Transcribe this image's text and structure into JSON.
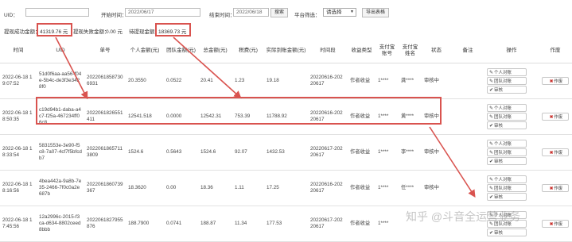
{
  "filter": {
    "uid_label": "UID：",
    "uid_value": "",
    "start_label": "开始时间：",
    "start_value": "2022/06/17",
    "end_label": "结束时间：",
    "end_value": "2022/06/18",
    "search_label": "搜索",
    "platform_label": "平台筛选：",
    "platform_value": "请选择",
    "export_label": "导出表格"
  },
  "summary": {
    "success_label": "提现成功金额：",
    "success_value": "41319.76 元",
    "fail_label": "提现失败金额：",
    "fail_value": "0.00 元",
    "pending_label": "待提现金额：",
    "pending_value": "18369.73 元"
  },
  "table": {
    "headers": [
      "时间",
      "UID",
      "单号",
      "个人金额(元)",
      "团队金额(元)",
      "总金额(元)",
      "税费(元)",
      "实际到账金额(元)",
      "时间段",
      "收益类型",
      "支付宝账号",
      "支付宝姓名",
      "状态",
      "备注",
      "操作",
      "作废"
    ],
    "action_labels": {
      "personal": "个人对账",
      "team": "团队对账",
      "review": "审核"
    },
    "void_label": "作废",
    "rows": [
      {
        "time": "2022-06-18 19:07:52",
        "uid": "51d0f6aa-aa56-f04e-5b4c-de3f3e3428f0",
        "order": "2022061858730 6931",
        "personal": "20.3550",
        "team": "0.0522",
        "total": "20.41",
        "tax": "1.23",
        "actual": "19.18",
        "period": "20220616-20220617",
        "type": "作者收益",
        "account": "1****",
        "name": "龚****",
        "status": "审核中",
        "note": ""
      },
      {
        "time": "2022-06-18 18:50:35",
        "uid": "c19d94b1-daba-a4c7-f25a-467234ff06c8",
        "order": "2022061826551411",
        "personal": "12541.518",
        "team": "0.0000",
        "total": "12542.31",
        "tax": "753.39",
        "actual": "11788.92",
        "period": "20220616-20220617",
        "type": "作者收益",
        "account": "1****",
        "name": "黄****",
        "status": "审核中",
        "note": ""
      },
      {
        "time": "2022-06-18 18:33:54",
        "uid": "5831553e-3e90-f5c8-7a07-4cf7f5bfcdb7",
        "order": "2022061865711 3809",
        "personal": "1524.6",
        "team": "0.5643",
        "total": "1524.6",
        "tax": "92.07",
        "actual": "1432.53",
        "period": "20220617-20220617",
        "type": "作者收益",
        "account": "1****",
        "name": "李****",
        "status": "审核中",
        "note": ""
      },
      {
        "time": "2022-06-18 18:16:56",
        "uid": "4bea442a-9a8b-7e35-2466-7f0c0a2e687b",
        "order": "2022061860739367",
        "personal": "18.3620",
        "team": "0.00",
        "total": "18.36",
        "tax": "1.11",
        "actual": "17.25",
        "period": "20220616-20220617",
        "type": "作者收益",
        "account": "1****",
        "name": "任****",
        "status": "审核中",
        "note": ""
      },
      {
        "time": "2022-06-18 17:45:56",
        "uid": "12a2996c-2015-f3ca-d634-8802ceed8bbb",
        "order": "2022061827955876",
        "personal": "188.7900",
        "team": "0.0741",
        "total": "188.87",
        "tax": "11.34",
        "actual": "177.53",
        "period": "20220617-20220617",
        "type": "作者收益",
        "account": "1****",
        "name": "",
        "status": "",
        "note": ""
      }
    ]
  },
  "watermark": "知乎 @斗音全运营业务",
  "colors": {
    "highlight": "#d9534f",
    "void_icon": "#c9302c"
  }
}
